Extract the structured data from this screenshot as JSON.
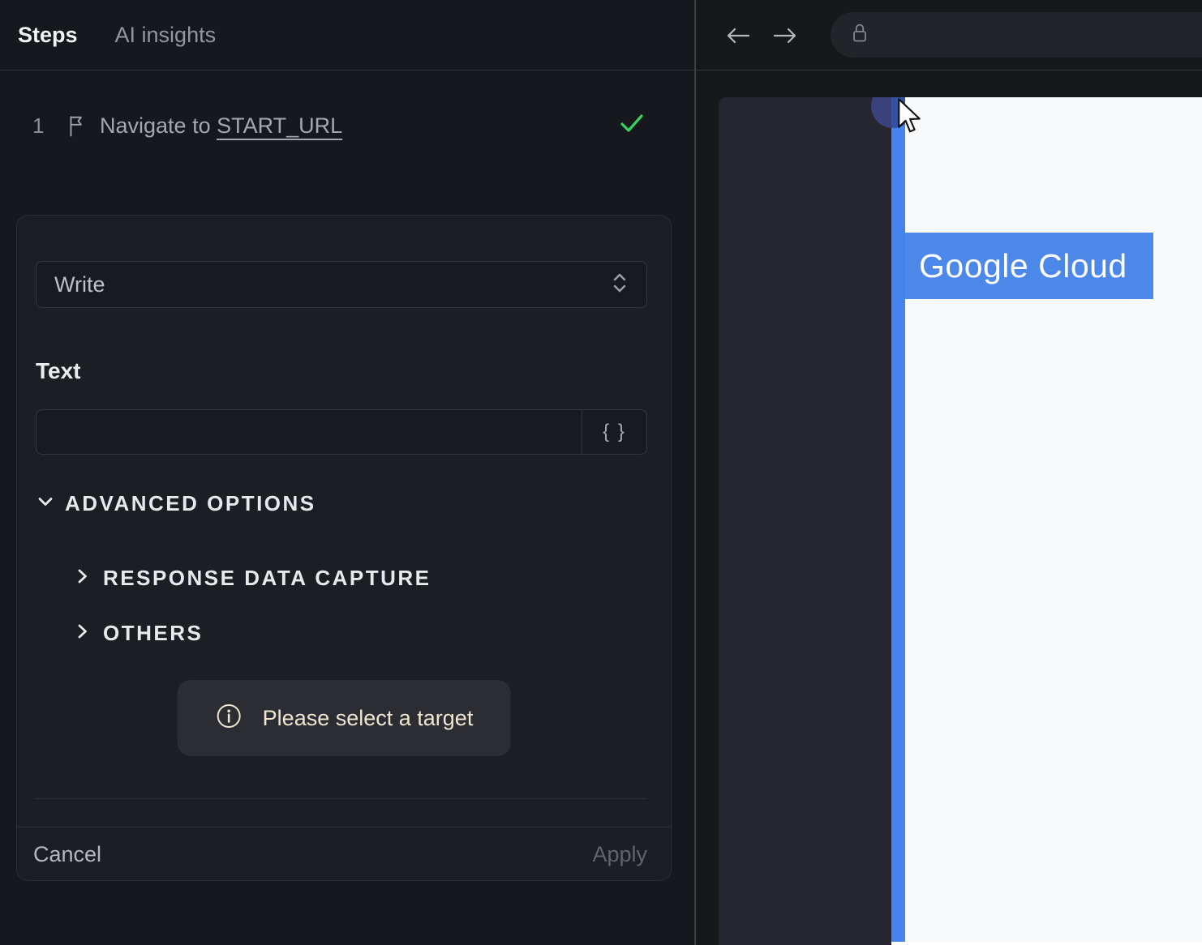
{
  "left_panel": {
    "tabs": [
      {
        "label": "Steps"
      },
      {
        "label": "AI insights"
      }
    ],
    "step": {
      "number": "1",
      "text": "Navigate to",
      "link": "START_URL",
      "status": "success"
    },
    "editor": {
      "action_value": "Write",
      "text_label": "Text",
      "input_value": "",
      "variable_button_label": "{ }",
      "advanced_label": "ADVANCED OPTIONS",
      "sections": [
        {
          "label": "RESPONSE DATA CAPTURE"
        },
        {
          "label": "OTHERS"
        }
      ],
      "notice": "Please select a target",
      "cancel_label": "Cancel",
      "apply_label": "Apply"
    }
  },
  "browser": {
    "url_value": "",
    "page_brand": "Google Cloud"
  },
  "icons": {
    "step": "flag-icon",
    "status": "check-icon",
    "select": "chevron-up-down-icon",
    "notice": "info-icon",
    "nav": [
      "arrow-left-icon",
      "arrow-right-icon"
    ],
    "url": "lock-icon",
    "pointer": "cursor-icon"
  },
  "colors": {
    "accent_blue": "#4584ec",
    "banner_blue": "#4c87ea",
    "success_green": "#36d25f",
    "notice_cream": "#eee6d3",
    "panel_dark": "#17181c",
    "card_dark": "#1d1e24",
    "site_sidebar": "#25262f",
    "site_page": "#f8f9fa"
  }
}
